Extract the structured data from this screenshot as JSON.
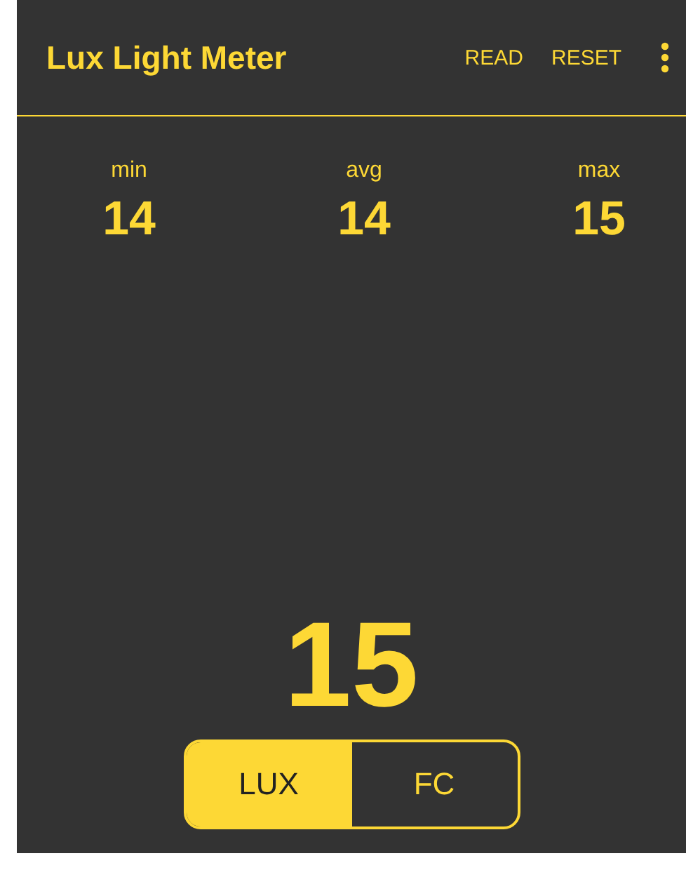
{
  "app_bar": {
    "title": "Lux Light Meter",
    "actions": [
      "READ",
      "RESET"
    ]
  },
  "stats": [
    {
      "label": "min",
      "value": "14"
    },
    {
      "label": "avg",
      "value": "14"
    },
    {
      "label": "max",
      "value": "15"
    }
  ],
  "reading": "15",
  "units": [
    {
      "label": "LUX",
      "selected": true
    },
    {
      "label": "FC",
      "selected": false
    }
  ]
}
